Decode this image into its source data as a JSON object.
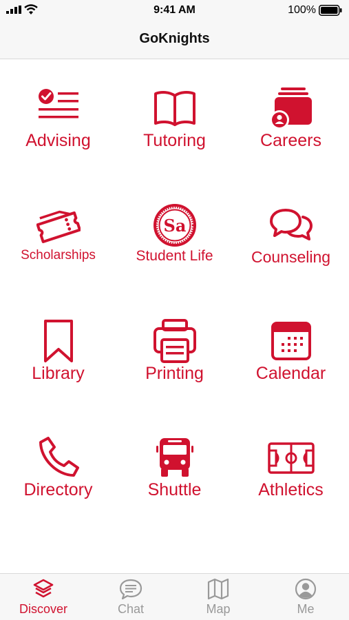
{
  "status_bar": {
    "time": "9:41 AM",
    "battery": "100%"
  },
  "nav": {
    "title": "GoKnights"
  },
  "accent_color": "#d0122f",
  "inactive_color": "#999999",
  "grid": {
    "items": [
      {
        "label": "Advising",
        "icon": "checklist-icon"
      },
      {
        "label": "Tutoring",
        "icon": "open-book-icon"
      },
      {
        "label": "Careers",
        "icon": "folders-person-icon"
      },
      {
        "label": "Scholarships",
        "icon": "ticket-icon"
      },
      {
        "label": "Student Life",
        "icon": "student-life-logo",
        "logo_text": "Sa"
      },
      {
        "label": "Counseling",
        "icon": "chat-bubbles-icon"
      },
      {
        "label": "Library",
        "icon": "bookmark-icon"
      },
      {
        "label": "Printing",
        "icon": "printer-icon"
      },
      {
        "label": "Calendar",
        "icon": "calendar-icon"
      },
      {
        "label": "Directory",
        "icon": "phone-icon"
      },
      {
        "label": "Shuttle",
        "icon": "bus-icon"
      },
      {
        "label": "Athletics",
        "icon": "soccer-field-icon"
      }
    ]
  },
  "tabbar": {
    "tabs": [
      {
        "label": "Discover",
        "icon": "layers-icon",
        "active": true
      },
      {
        "label": "Chat",
        "icon": "chat-bubble-icon",
        "active": false
      },
      {
        "label": "Map",
        "icon": "map-icon",
        "active": false
      },
      {
        "label": "Me",
        "icon": "user-circle-icon",
        "active": false
      }
    ]
  }
}
